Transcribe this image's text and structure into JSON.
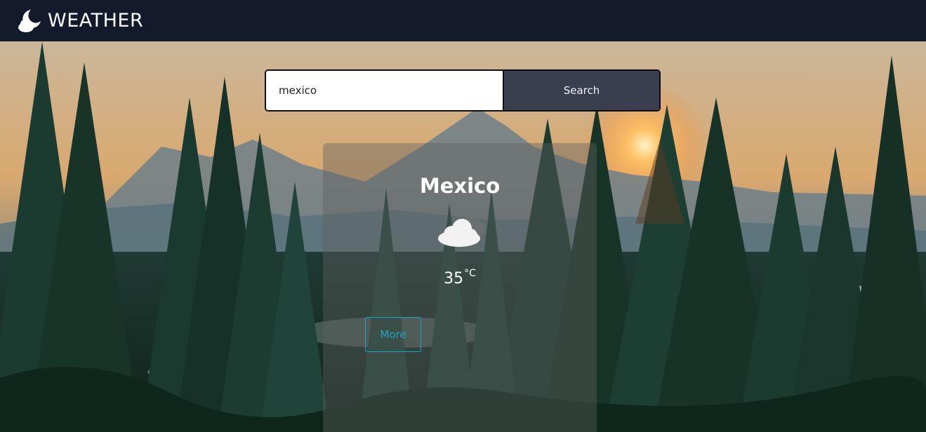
{
  "app": {
    "brand_text": "WEATHER",
    "brand_icon": "moon-cloud-icon"
  },
  "search": {
    "value": "mexico",
    "button_label": "Search"
  },
  "weather": {
    "city": "Mexico",
    "condition_icon": "cloud-icon",
    "temperature": "35",
    "unit": "°C",
    "more_label": "More"
  },
  "colors": {
    "navbar": "#131a2b",
    "search_button": "#3a3f4f",
    "more_accent": "#1ea4c9"
  }
}
